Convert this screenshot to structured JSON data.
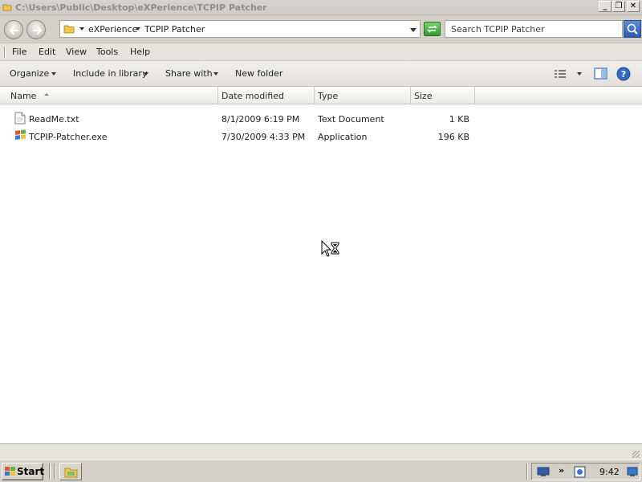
{
  "window": {
    "title": "C:\\Users\\Public\\Desktop\\eXPerience\\TCPIP Patcher",
    "minimize_glyph": "_",
    "restore_glyph": "❐",
    "close_glyph": "✕"
  },
  "address": {
    "crumbs": [
      "eXPerience",
      "TCPIP Patcher"
    ]
  },
  "search": {
    "placeholder": "Search TCPIP Patcher"
  },
  "menu": {
    "items": [
      "File",
      "Edit",
      "View",
      "Tools",
      "Help"
    ]
  },
  "commands": {
    "organize": "Organize",
    "include_library": "Include in library",
    "share_with": "Share with",
    "new_folder": "New folder"
  },
  "columns": {
    "name": "Name",
    "date": "Date modified",
    "type": "Type",
    "size": "Size"
  },
  "files": [
    {
      "name": "ReadMe.txt",
      "date": "8/1/2009 6:19 PM",
      "type": "Text Document",
      "size": "1 KB",
      "icon": "text-file-icon"
    },
    {
      "name": "TCPIP-Patcher.exe",
      "date": "7/30/2009 4:33 PM",
      "type": "Application",
      "size": "196 KB",
      "icon": "application-icon"
    }
  ],
  "taskbar": {
    "start_label": "Start",
    "clock": "9:42",
    "tray_chevron": "»"
  },
  "colors": {
    "chrome": "#d4d0c8",
    "title_text": "#8f8b85",
    "accent_blue": "#2a5bb0"
  }
}
